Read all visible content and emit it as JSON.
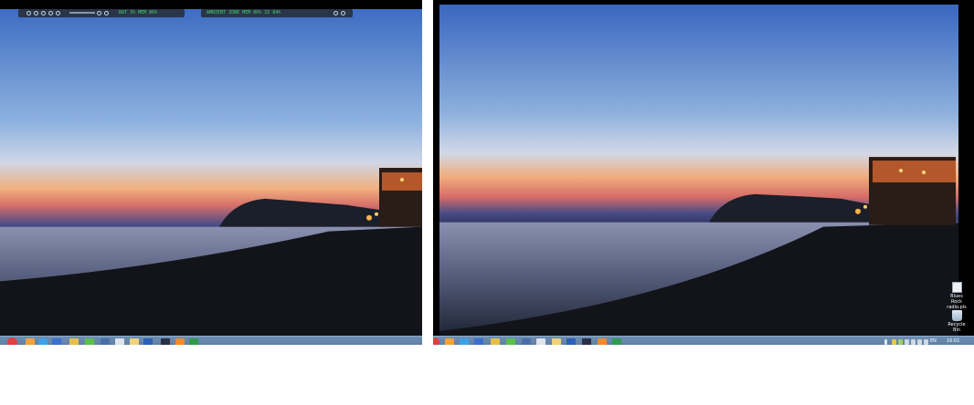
{
  "left_monitor": {
    "widget_a": {
      "text": "BAT 3% MEM 86%"
    },
    "widget_b": {
      "text": "AMBIENT ZONE  MEM 86% 15 84%"
    },
    "taskbar_apps": [
      "firefox",
      "ie",
      "word-blue",
      "paint",
      "media",
      "wmp",
      "chrome",
      "folder",
      "word",
      "app-dark",
      "vlc",
      "excel"
    ]
  },
  "right_monitor": {
    "taskbar_apps": [
      "firefox",
      "ie",
      "word-blue",
      "paint",
      "media",
      "wmp",
      "chrome",
      "folder",
      "word",
      "app-dark",
      "vlc",
      "excel"
    ],
    "tray": {
      "language": "EN",
      "clock": "16:01"
    },
    "desktop_icons": [
      {
        "label": "Blues Rock radio.pls",
        "icon": "file-icon"
      },
      {
        "label": "Recycle Bin",
        "icon": "recycle-bin-icon"
      }
    ]
  },
  "colors": {
    "sky_top": "#3f6fc4",
    "horizon_orange": "#f0a36a",
    "sea": "#2a3347",
    "beach": "#15171d",
    "taskbar": "#5f80a6"
  }
}
